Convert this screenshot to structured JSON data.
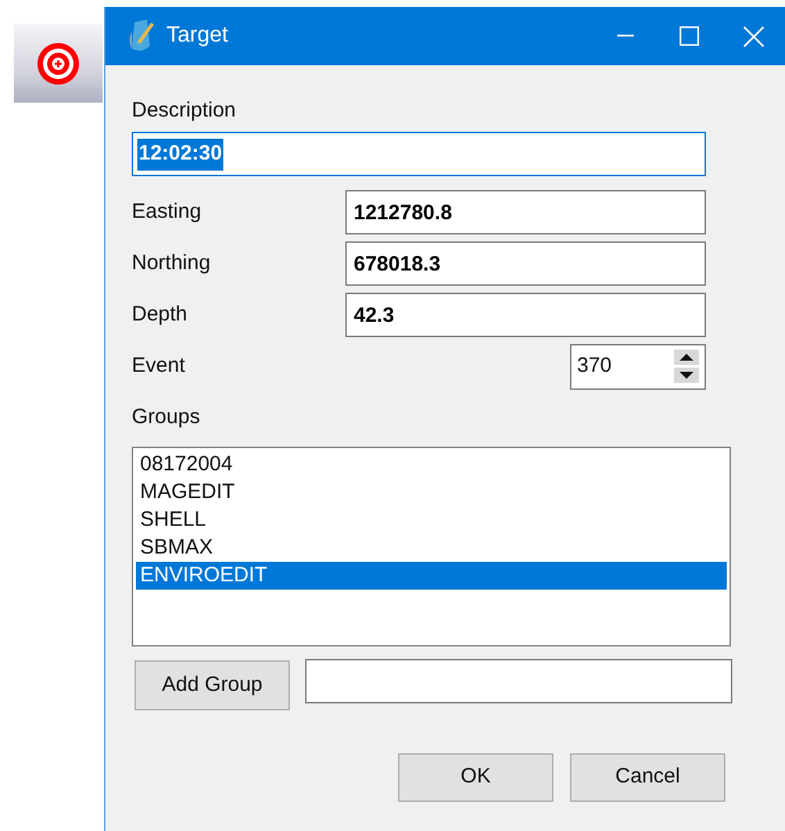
{
  "toolbar": {
    "buttons": [
      {
        "kind": "target",
        "selected": true
      }
    ]
  },
  "window": {
    "title": "Target",
    "controls": [
      {
        "kind": "minimize"
      },
      {
        "kind": "maximize"
      },
      {
        "kind": "close"
      }
    ]
  },
  "description": {
    "label": "Description",
    "value": "12:02:30",
    "text_selected": true,
    "focused": true
  },
  "fields": [
    {
      "label": "Easting",
      "value": "1212780.8"
    },
    {
      "label": "Northing",
      "value": "678018.3"
    },
    {
      "label": "Depth",
      "value": "42.3"
    }
  ],
  "event": {
    "label": "Event",
    "value": "370"
  },
  "groups": {
    "label": "Groups",
    "items": [
      {
        "text": "08172004",
        "selected": false
      },
      {
        "text": "MAGEDIT",
        "selected": false
      },
      {
        "text": "SHELL",
        "selected": false
      },
      {
        "text": "SBMAX",
        "selected": false
      },
      {
        "text": "ENVIROEDIT",
        "selected": true
      }
    ]
  },
  "add_group": {
    "button": "Add Group"
  },
  "buttons": [
    "OK",
    "Cancel"
  ]
}
